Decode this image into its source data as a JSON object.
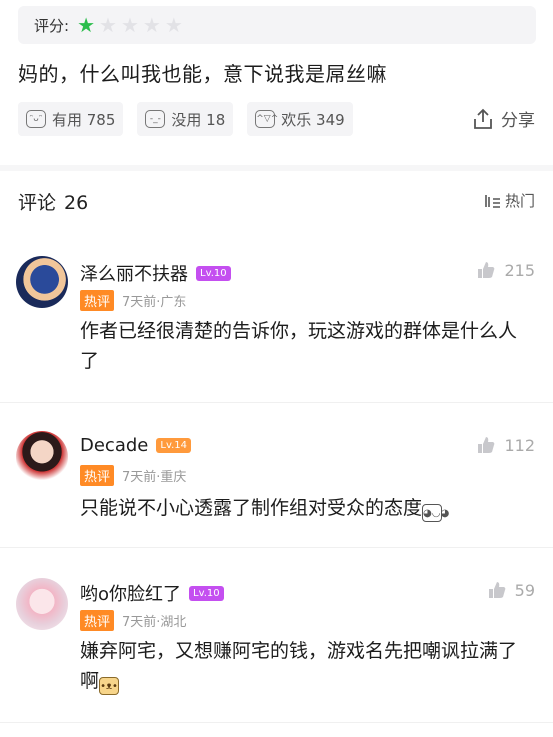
{
  "review": {
    "rating_label": "评分:",
    "rating_value": 1,
    "rating_max": 5,
    "text": "妈的，什么叫我也能，意下说我是屌丝嘛",
    "reactions": [
      {
        "label": "有用 785",
        "icon": "useful-face-icon"
      },
      {
        "label": "没用 18",
        "icon": "useless-face-icon"
      },
      {
        "label": "欢乐 349",
        "icon": "funny-face-icon"
      }
    ],
    "share_label": "分享"
  },
  "comments_header": {
    "title": "评论",
    "count": "26",
    "sort_label": "热门"
  },
  "comments": [
    {
      "name": "泽么丽不扶器",
      "level": "Lv.10",
      "tag": "热评",
      "meta": "7天前·广东",
      "text": "作者已经很清楚的告诉你，玩这游戏的群体是什么人了",
      "likes": "215"
    },
    {
      "name": "Decade",
      "level": "Lv.14",
      "tag": "热评",
      "meta": "7天前·重庆",
      "text": "只能说不小心透露了制作组对受众的态度",
      "likes": "112"
    },
    {
      "name": "哟o你脸红了",
      "level": "Lv.10",
      "tag": "热评",
      "meta": "7天前·湖北",
      "text": "嫌弃阿宅，又想赚阿宅的钱，游戏名先把嘲讽拉满了啊",
      "likes": "59"
    }
  ],
  "colors": {
    "star_on": "#2bbd4c",
    "star_off": "#e2e2e6",
    "hot_tag": "#ff8a25",
    "level_badge": "#c44ff0"
  }
}
